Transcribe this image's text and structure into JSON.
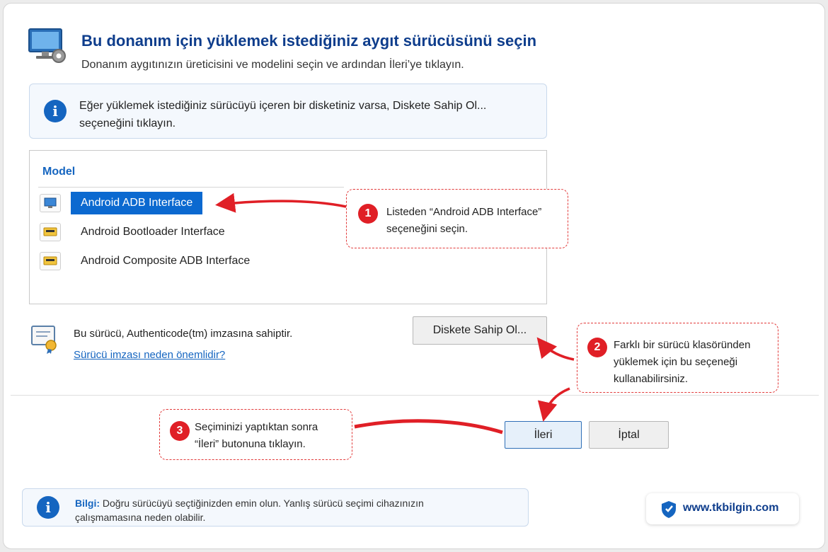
{
  "header": {
    "title": "Bu donanım için yüklemek istediğiniz aygıt sürücüsünü seçin",
    "subtitle": "Donanım aygıtınızın üreticisini ve modelini seçin ve ardından İleri’ye tıklayın."
  },
  "info": {
    "line1": "Eğer yüklemek istediğiniz sürücüyü içeren bir disketiniz varsa, Diskete Sahip Ol...",
    "line2": "seçeneğini tıklayın."
  },
  "model": {
    "header": "Model",
    "items": [
      {
        "label": "Android ADB Interface",
        "selected": true
      },
      {
        "label": "Android Bootloader Interface",
        "selected": false
      },
      {
        "label": "Android Composite ADB Interface",
        "selected": false
      }
    ]
  },
  "signature": {
    "text": "Bu sürücü, Authenticode(tm) imzasına sahiptir.",
    "link": "Sürücü imzası neden önemlidir?"
  },
  "buttons": {
    "disk": "Diskete Sahip Ol...",
    "next": "İleri",
    "cancel": "İptal"
  },
  "callouts": [
    {
      "number": "1",
      "line1": "Listeden “Android ADB Interface”",
      "line2": "seçeneğini seçin."
    },
    {
      "number": "2",
      "line1": "Farklı bir sürücü klasöründen",
      "line2": "yüklemek için bu seçeneği",
      "line3": "kullanabilirsiniz."
    },
    {
      "number": "3",
      "line1": "Seçiminizi yaptıktan sonra",
      "line2": "“İleri” butonuna tıklayın."
    }
  ],
  "bottom": {
    "label": "Bilgi:",
    "line1": "Doğru sürücüyü seçtiğinizden emin olun. Yanlış sürücü seçimi cihazınızın",
    "line2": "çalışmamasına neden olabilir."
  },
  "brand": {
    "text": "www.tkbilgin.com"
  },
  "colors": {
    "accent": "#1565c0",
    "selection": "#0b69d0",
    "annotation": "#e01f26",
    "title": "#0e3d8c"
  }
}
